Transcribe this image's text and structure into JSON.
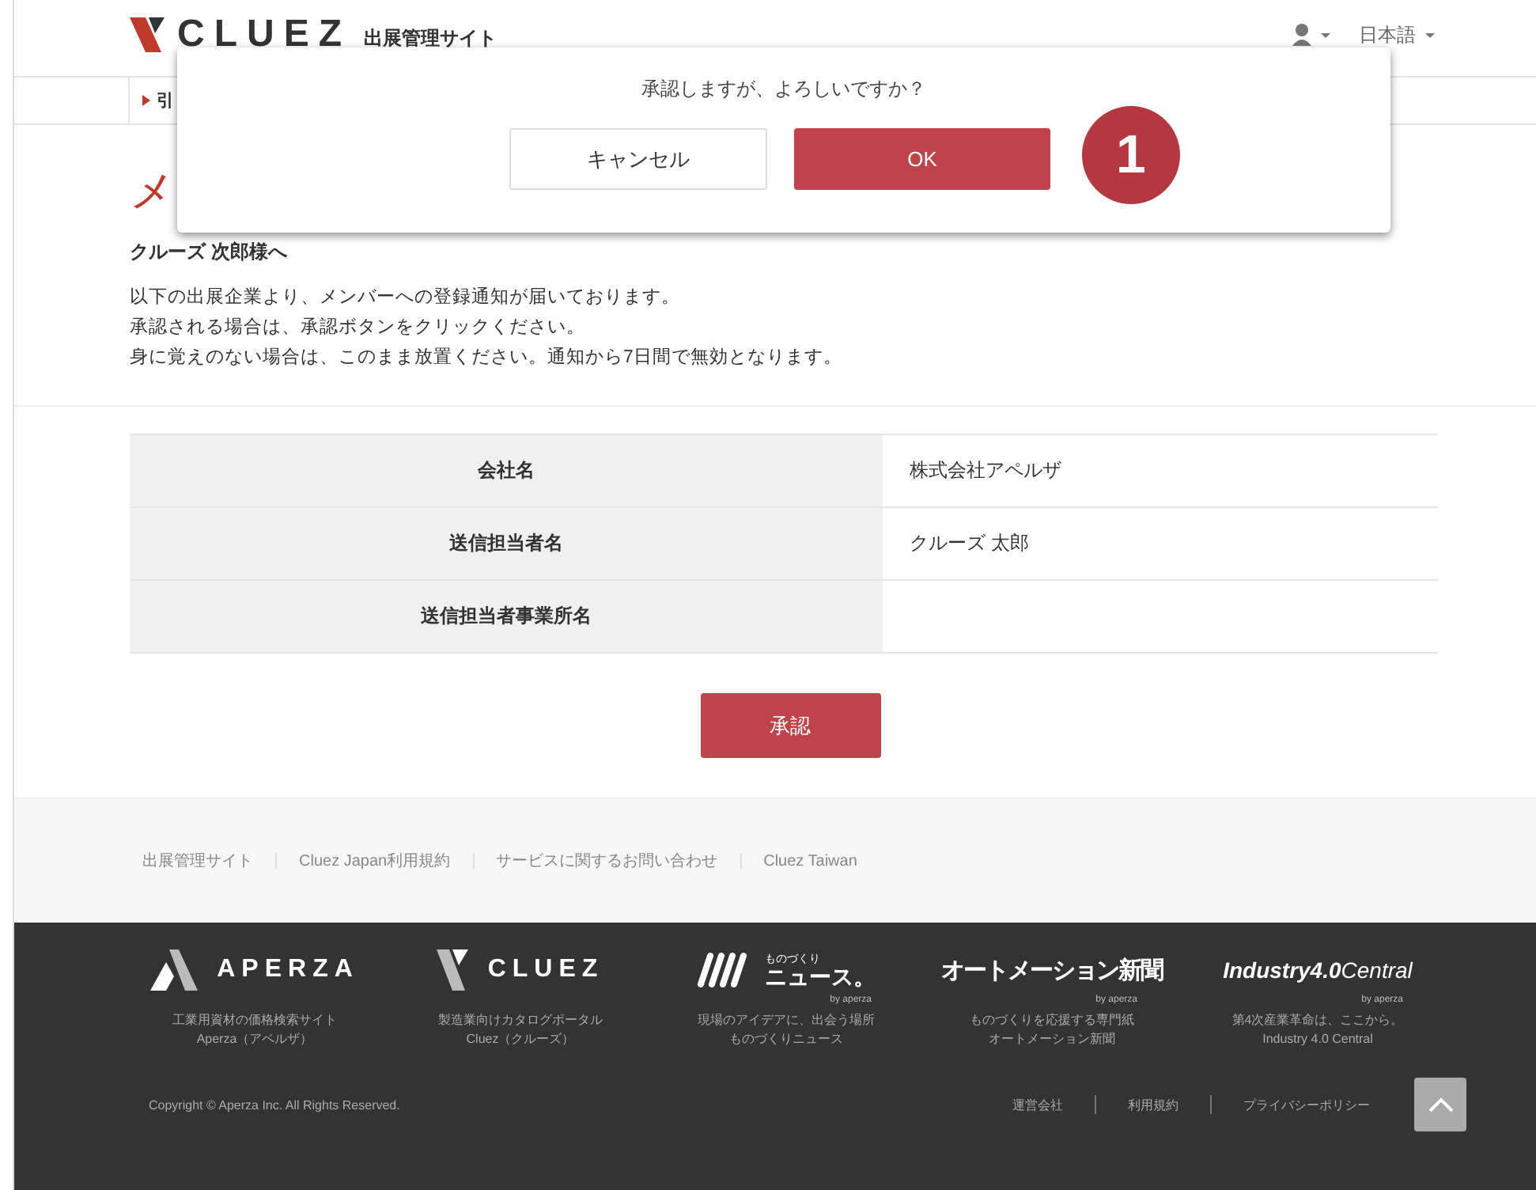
{
  "header": {
    "logo": "CLUEZ",
    "site_name": "出展管理サイト",
    "language": "日本語"
  },
  "breadcrumb": {
    "text": "引"
  },
  "page_title": "メ",
  "greeting": "クルーズ 次郎様へ",
  "message_lines": [
    "以下の出展企業より、メンバーへの登録通知が届いております。",
    "承認される場合は、承認ボタンをクリックください。",
    "身に覚えのない場合は、このまま放置ください。通知から7日間で無効となります。"
  ],
  "table": {
    "rows": [
      {
        "label": "会社名",
        "value": "株式会社アペルザ"
      },
      {
        "label": "送信担当者名",
        "value": "クルーズ 太郎"
      },
      {
        "label": "送信担当者事業所名",
        "value": ""
      }
    ]
  },
  "approve_button": "承認",
  "dialog": {
    "message": "承認しますが、よろしいですか？",
    "cancel": "キャンセル",
    "ok": "OK",
    "step_badge": "1"
  },
  "footer_links": [
    "出展管理サイト",
    "Cluez Japan利用規約",
    "サービスに関するお問い合わせ",
    "Cluez Taiwan"
  ],
  "footer_brands": [
    {
      "kind": "aperza",
      "name": "APERZA",
      "desc": [
        "工業用資材の価格検索サイト",
        "Aperza（アペルザ）"
      ]
    },
    {
      "kind": "cluez",
      "name": "CLUEZ",
      "desc": [
        "製造業向けカタログポータル",
        "Cluez（クルーズ）"
      ]
    },
    {
      "kind": "news",
      "name": "ニュース。",
      "top": "ものづくり",
      "byline": "by aperza",
      "desc": [
        "現場のアイデアに、出会う場所",
        "ものづくりニュース"
      ]
    },
    {
      "kind": "paper",
      "name": "オートメーション新聞",
      "byline": "by aperza",
      "desc": [
        "ものづくりを応援する専門紙",
        "オートメーション新聞"
      ]
    },
    {
      "kind": "industry",
      "name": "Industry4.0",
      "name2": "Central",
      "byline": "by aperza",
      "desc": [
        "第4次産業革命は、ここから。",
        "Industry 4.0 Central"
      ]
    }
  ],
  "copyright": "Copyright © Aperza Inc. All Rights Reserved.",
  "bottom_links": [
    "運営会社",
    "利用規約",
    "プライバシーポリシー"
  ]
}
